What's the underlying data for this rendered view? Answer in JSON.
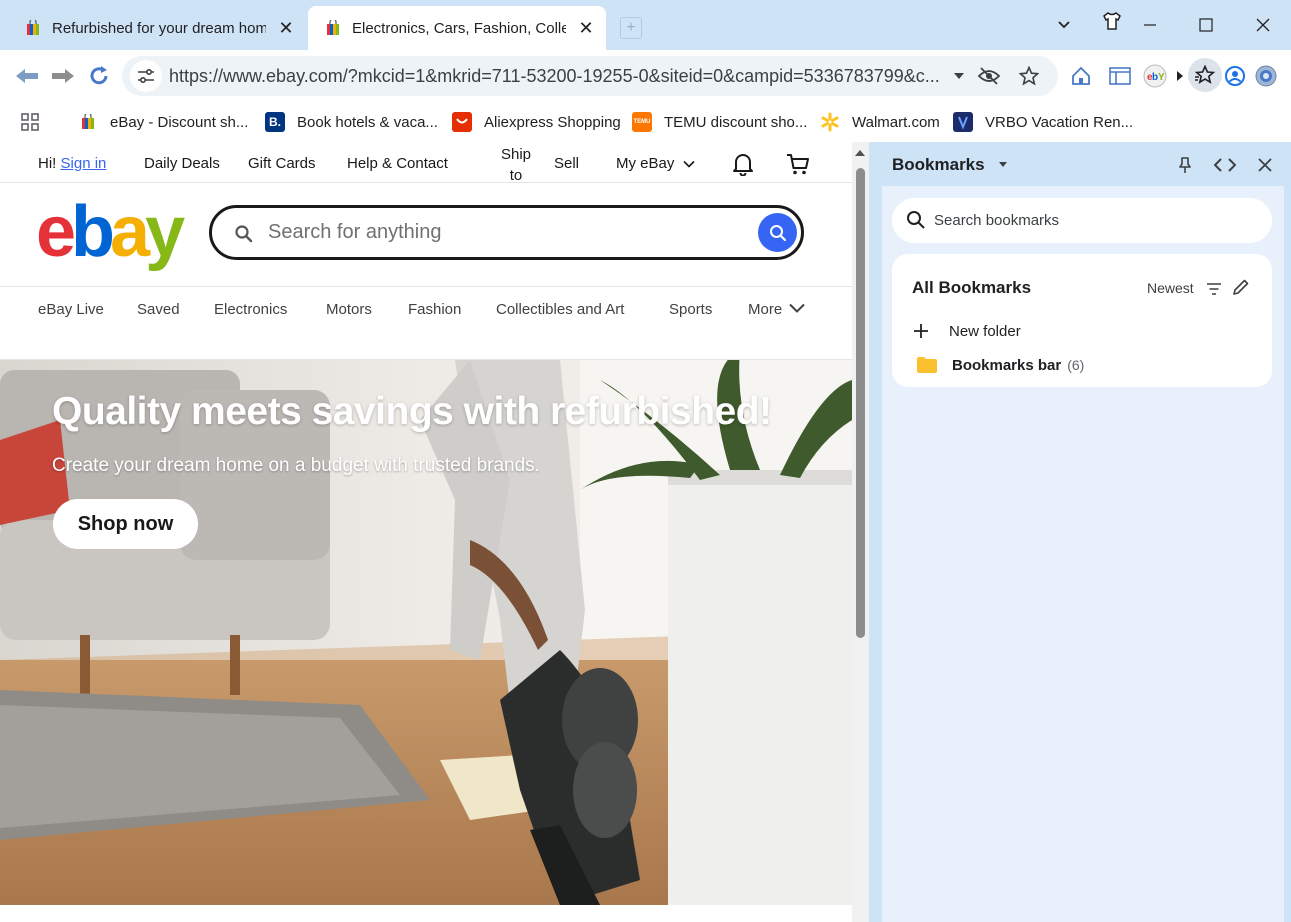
{
  "tabs": [
    {
      "title": "Refurbished for your dream hom",
      "active": false
    },
    {
      "title": "Electronics, Cars, Fashion, Collect",
      "active": true
    }
  ],
  "omnibox": {
    "url": "https://www.ebay.com/?mkcid=1&mkrid=711-53200-19255-0&siteid=0&campid=5336783799&c..."
  },
  "bookmarks_bar": [
    {
      "label": "eBay - Discount sh...",
      "icon": "ebay-bag-icon"
    },
    {
      "label": "Book hotels & vaca...",
      "icon": "booking-icon",
      "color": "#003580"
    },
    {
      "label": "Aliexpress Shopping",
      "icon": "aliexpress-icon",
      "color": "#e62e04"
    },
    {
      "label": "TEMU discount sho...",
      "icon": "temu-icon",
      "color": "#fb7701"
    },
    {
      "label": "Walmart.com",
      "icon": "walmart-spark-icon",
      "color": "#ffc220"
    },
    {
      "label": "VRBO Vacation Ren...",
      "icon": "vrbo-icon",
      "color": "#1c2c6b"
    }
  ],
  "ebay": {
    "topnav": {
      "greeting": "Hi!",
      "sign_in": "Sign in",
      "daily_deals": "Daily Deals",
      "gift_cards": "Gift Cards",
      "help": "Help & Contact",
      "ship_line1": "Ship",
      "ship_line2": "to",
      "sell": "Sell",
      "my_ebay": "My eBay"
    },
    "logo_letters": [
      "e",
      "b",
      "a",
      "y"
    ],
    "logo_colors": [
      "#e53238",
      "#0064d2",
      "#f5af02",
      "#86b817"
    ],
    "search_placeholder": "Search for anything",
    "categories": [
      "eBay Live",
      "Saved",
      "Electronics",
      "Motors",
      "Fashion",
      "Collectibles and Art",
      "Sports",
      "More"
    ],
    "hero": {
      "title": "Quality meets savings with refurbished!",
      "subtitle": "Create your dream home on a budget with trusted brands.",
      "cta": "Shop now"
    }
  },
  "side_panel": {
    "title": "Bookmarks",
    "search_placeholder": "Search bookmarks",
    "section_title": "All Bookmarks",
    "sort_label": "Newest",
    "new_folder": "New folder",
    "folder_name": "Bookmarks bar",
    "folder_count": "(6)"
  },
  "colors": {
    "chrome_frame": "#cfe3f7",
    "ebay_blue": "#3665f3",
    "panel_bg": "#e8f1fb"
  }
}
